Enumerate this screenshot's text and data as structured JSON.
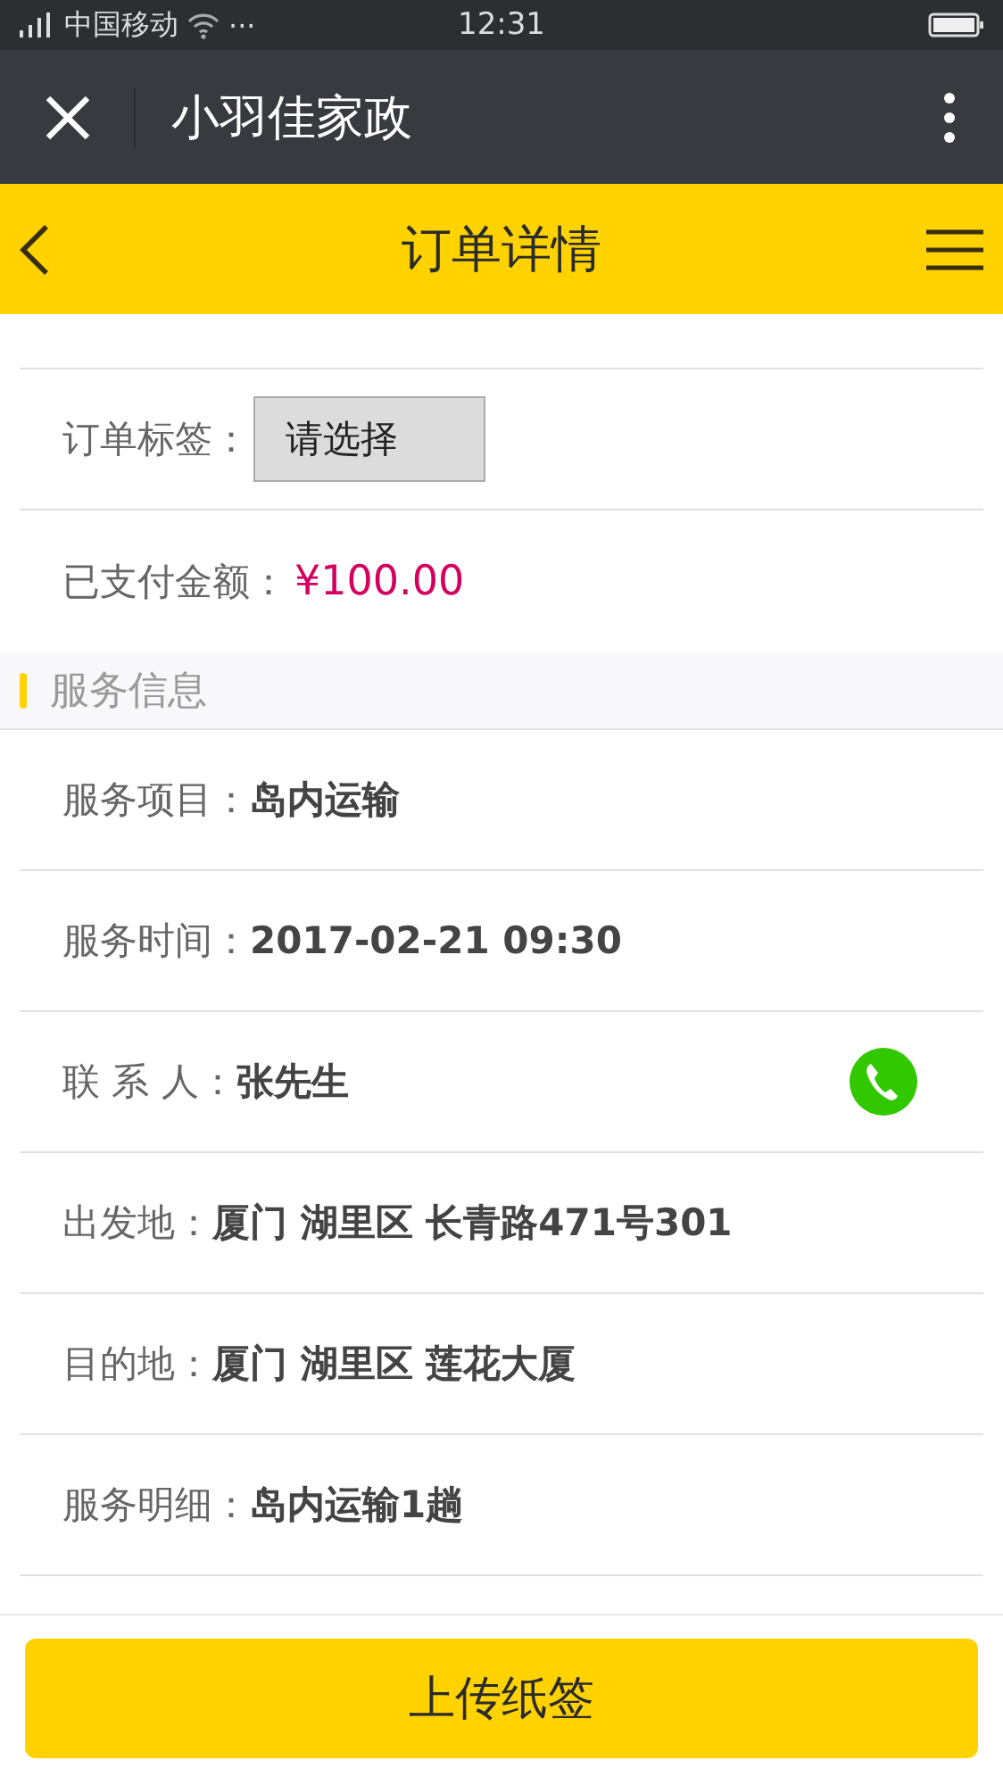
{
  "status_bar": {
    "carrier": "中国移动",
    "more": "···",
    "time": "12:31"
  },
  "wechat_bar": {
    "title": "小羽佳家政"
  },
  "header": {
    "title": "订单详情"
  },
  "order_rows": [
    {
      "kind": "select",
      "label": "订单标签：",
      "value": "请选择"
    },
    {
      "kind": "amount",
      "label": "已支付金额：",
      "value": "¥100.00"
    }
  ],
  "section": {
    "title": "服务信息"
  },
  "service_rows": [
    {
      "kind": "text",
      "label": "服务项目：",
      "value": "岛内运输"
    },
    {
      "kind": "text",
      "label": "服务时间：",
      "value": "2017-02-21 09:30"
    },
    {
      "kind": "contact",
      "label": "联 系 人：",
      "value": "张先生"
    },
    {
      "kind": "text",
      "label": "出发地：",
      "value": "厦门 湖里区 长青路471号301"
    },
    {
      "kind": "text",
      "label": "目的地：",
      "value": "厦门 湖里区 莲花大厦"
    },
    {
      "kind": "text",
      "label": "服务明细：",
      "value": "岛内运输1趟"
    }
  ],
  "footer_button": "上传纸签"
}
